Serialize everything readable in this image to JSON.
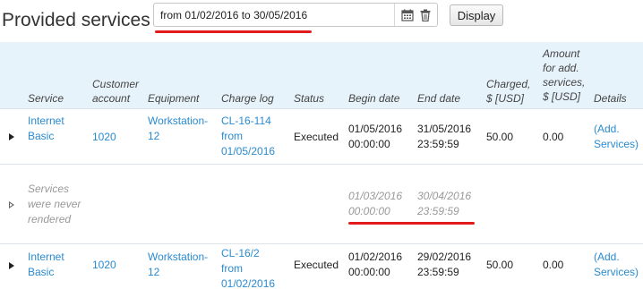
{
  "page": {
    "title": "Provided services",
    "date_range": "from 01/02/2016 to 30/05/2016",
    "display_label": "Display"
  },
  "columns": {
    "service": "Service",
    "customer_account": [
      "Customer",
      "account"
    ],
    "equipment": "Equipment",
    "charge_log": "Charge log",
    "status": "Status",
    "begin_date": "Begin date",
    "end_date": "End date",
    "charged": [
      "Charged,",
      "$ [USD]"
    ],
    "amount_add": [
      "Amount",
      "for add.",
      "services,",
      "$ [USD]"
    ],
    "details": "Details"
  },
  "rows": [
    {
      "service": [
        "Internet",
        "Basic"
      ],
      "account": "1020",
      "equipment": [
        "Workstation-",
        "12"
      ],
      "charge_log": [
        "CL-16-114",
        "from",
        "01/05/2016"
      ],
      "status": "Executed",
      "begin": [
        "01/05/2016",
        "00:00:00"
      ],
      "end": [
        "31/05/2016",
        "23:59:59"
      ],
      "charged": "50.00",
      "amount_add": "0.00",
      "details": [
        "(Add.",
        "Services)"
      ]
    },
    {
      "service": [
        "Services",
        "were never",
        "rendered"
      ],
      "begin": [
        "01/03/2016",
        "00:00:00"
      ],
      "end": [
        "30/04/2016",
        "23:59:59"
      ]
    },
    {
      "service": [
        "Internet",
        "Basic"
      ],
      "account": "1020",
      "equipment": [
        "Workstation-",
        "12"
      ],
      "charge_log": [
        "CL-16/2",
        "from",
        "01/02/2016"
      ],
      "status": "Executed",
      "begin": [
        "01/02/2016",
        "00:00:00"
      ],
      "end": [
        "29/02/2016",
        "23:59:59"
      ],
      "charged": "50.00",
      "amount_add": "0.00",
      "details": [
        "(Add.",
        "Services)"
      ]
    }
  ],
  "colors": {
    "link": "#2a8bd0",
    "header_bg": "#e7f3fb",
    "highlight": "#e21c1c"
  },
  "icons": [
    "calendar-icon",
    "trash-icon",
    "expand-arrow-icon"
  ]
}
